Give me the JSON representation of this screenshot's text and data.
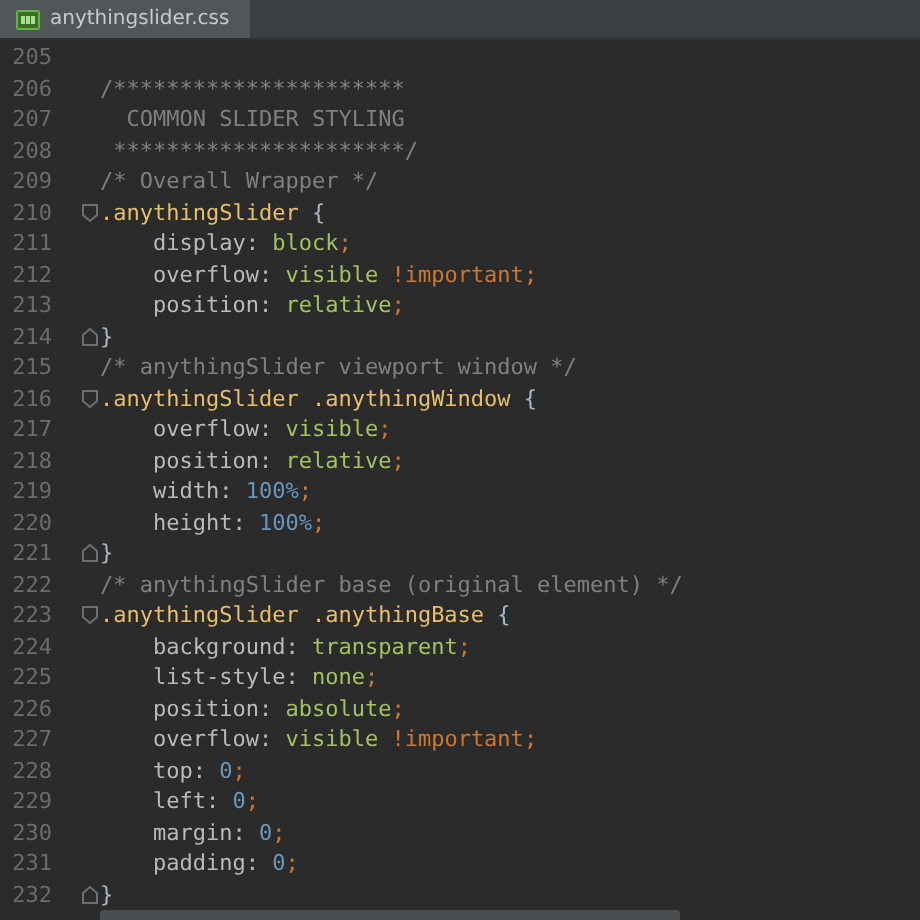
{
  "tab": {
    "label": "anythingslider.css",
    "selected": true
  },
  "lines": [
    {
      "number": "205"
    },
    {
      "number": "206",
      "tokens": [
        {
          "kind": "comment",
          "text": "/**********************"
        }
      ]
    },
    {
      "number": "207",
      "tokens": [
        {
          "kind": "comment",
          "text": "  COMMON SLIDER STYLING"
        }
      ]
    },
    {
      "number": "208",
      "tokens": [
        {
          "kind": "comment",
          "text": " **********************/"
        }
      ]
    },
    {
      "number": "209",
      "tokens": [
        {
          "kind": "comment",
          "text": "/* Overall Wrapper */"
        }
      ]
    },
    {
      "number": "210",
      "fold_start": true,
      "tokens": [
        {
          "kind": "selector",
          "text": ".anythingSlider"
        },
        {
          "kind": "brace",
          "text": " {"
        }
      ]
    },
    {
      "number": "211",
      "tokens": [
        {
          "kind": "property",
          "text": "    display: "
        },
        {
          "kind": "value",
          "text": "block"
        },
        {
          "kind": "punct",
          "text": ";"
        }
      ]
    },
    {
      "number": "212",
      "tokens": [
        {
          "kind": "property",
          "text": "    overflow: "
        },
        {
          "kind": "value",
          "text": "visible "
        },
        {
          "kind": "important",
          "text": "!important"
        },
        {
          "kind": "punct",
          "text": ";"
        }
      ]
    },
    {
      "number": "213",
      "tokens": [
        {
          "kind": "property",
          "text": "    position: "
        },
        {
          "kind": "value",
          "text": "relative"
        },
        {
          "kind": "punct",
          "text": ";"
        }
      ]
    },
    {
      "number": "214",
      "fold_end": true,
      "tokens": [
        {
          "kind": "brace",
          "text": "}"
        }
      ]
    },
    {
      "number": "215",
      "tokens": [
        {
          "kind": "comment",
          "text": "/* anythingSlider viewport window */"
        }
      ]
    },
    {
      "number": "216",
      "fold_start": true,
      "tokens": [
        {
          "kind": "selector",
          "text": ".anythingSlider .anythingWindow"
        },
        {
          "kind": "brace",
          "text": " {"
        }
      ]
    },
    {
      "number": "217",
      "tokens": [
        {
          "kind": "property",
          "text": "    overflow: "
        },
        {
          "kind": "value",
          "text": "visible"
        },
        {
          "kind": "punct",
          "text": ";"
        }
      ]
    },
    {
      "number": "218",
      "tokens": [
        {
          "kind": "property",
          "text": "    position: "
        },
        {
          "kind": "value",
          "text": "relative"
        },
        {
          "kind": "punct",
          "text": ";"
        }
      ]
    },
    {
      "number": "219",
      "tokens": [
        {
          "kind": "property",
          "text": "    width: "
        },
        {
          "kind": "number",
          "text": "100%"
        },
        {
          "kind": "punct",
          "text": ";"
        }
      ]
    },
    {
      "number": "220",
      "tokens": [
        {
          "kind": "property",
          "text": "    height: "
        },
        {
          "kind": "number",
          "text": "100%"
        },
        {
          "kind": "punct",
          "text": ";"
        }
      ]
    },
    {
      "number": "221",
      "fold_end": true,
      "tokens": [
        {
          "kind": "brace",
          "text": "}"
        }
      ]
    },
    {
      "number": "222",
      "tokens": [
        {
          "kind": "comment",
          "text": "/* anythingSlider base (original element) */"
        }
      ]
    },
    {
      "number": "223",
      "fold_start": true,
      "tokens": [
        {
          "kind": "selector",
          "text": ".anythingSlider .anythingBase"
        },
        {
          "kind": "brace",
          "text": " {"
        }
      ]
    },
    {
      "number": "224",
      "tokens": [
        {
          "kind": "property",
          "text": "    background: "
        },
        {
          "kind": "value",
          "text": "transparent"
        },
        {
          "kind": "punct",
          "text": ";"
        }
      ]
    },
    {
      "number": "225",
      "tokens": [
        {
          "kind": "property",
          "text": "    list-style: "
        },
        {
          "kind": "value",
          "text": "none"
        },
        {
          "kind": "punct",
          "text": ";"
        }
      ]
    },
    {
      "number": "226",
      "tokens": [
        {
          "kind": "property",
          "text": "    position: "
        },
        {
          "kind": "value",
          "text": "absolute"
        },
        {
          "kind": "punct",
          "text": ";"
        }
      ]
    },
    {
      "number": "227",
      "tokens": [
        {
          "kind": "property",
          "text": "    overflow: "
        },
        {
          "kind": "value",
          "text": "visible "
        },
        {
          "kind": "important",
          "text": "!important"
        },
        {
          "kind": "punct",
          "text": ";"
        }
      ]
    },
    {
      "number": "228",
      "tokens": [
        {
          "kind": "property",
          "text": "    top: "
        },
        {
          "kind": "number",
          "text": "0"
        },
        {
          "kind": "punct",
          "text": ";"
        }
      ]
    },
    {
      "number": "229",
      "tokens": [
        {
          "kind": "property",
          "text": "    left: "
        },
        {
          "kind": "number",
          "text": "0"
        },
        {
          "kind": "punct",
          "text": ";"
        }
      ]
    },
    {
      "number": "230",
      "tokens": [
        {
          "kind": "property",
          "text": "    margin: "
        },
        {
          "kind": "number",
          "text": "0"
        },
        {
          "kind": "punct",
          "text": ";"
        }
      ]
    },
    {
      "number": "231",
      "tokens": [
        {
          "kind": "property",
          "text": "    padding: "
        },
        {
          "kind": "number",
          "text": "0"
        },
        {
          "kind": "punct",
          "text": ";"
        }
      ]
    },
    {
      "number": "232",
      "fold_end": true,
      "tokens": [
        {
          "kind": "brace",
          "text": "}"
        }
      ]
    }
  ]
}
